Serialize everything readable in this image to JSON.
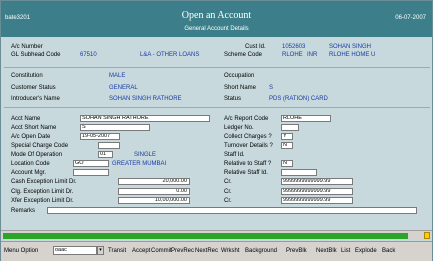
{
  "header": {
    "user": "bate3201",
    "title": "Open an Account",
    "subtitle": "General Account Details",
    "date": "06-07-2007"
  },
  "account": {
    "ac_number_label": "A/c Number",
    "gl_label": "GL Subhead Code",
    "gl_value": "67510",
    "gl_desc": "L&A - OTHER LOANS",
    "cust_id_label": "Cust Id.",
    "cust_id": "1052603",
    "cust_name": "SOHAN SINGH",
    "scheme_label": "Scheme Code",
    "scheme_code": "RLOHE",
    "scheme_ccy": "INR",
    "scheme_desc": "RLOHE HOME U"
  },
  "customer": {
    "constitution_label": "Constitution",
    "constitution": "MALE",
    "occupation_label": "Occupation",
    "occupation": "",
    "status_label": "Customer Status",
    "status": "GENERAL",
    "short_name_label": "Short Name",
    "short_name": "S",
    "introducer_label": "Introducer's Name",
    "introducer": "SOHAN SINGH RATHORE",
    "intro_status_label": "Status",
    "intro_status": "PDS (RATION) CARD"
  },
  "form": {
    "acct_name_label": "Acct Name",
    "acct_name": "SOHAN SINGH RATHORE",
    "acct_short_label": "Acct Short Name",
    "acct_short": "S",
    "open_date_label": "A/c Open Date",
    "open_date": "19-05-2007",
    "special_charge_label": "Special Charge Code",
    "special_charge": "",
    "mode_label": "Mode Of Operation",
    "mode_code": "01",
    "mode_desc": "SINGLE",
    "location_label": "Location Code",
    "location_code": "GO",
    "location_desc": "GREATER MUMBAI",
    "acct_mgr_label": "Account Mgr.",
    "acct_mgr": "",
    "cash_limit_label": "Cash Exception Limit Dr.",
    "cash_limit_dr": "20,000.00",
    "clg_limit_label": "Clg. Exception Limit Dr.",
    "clg_limit_dr": "0.00",
    "xfer_limit_label": "Xfer Exception Limit Dr.",
    "xfer_limit_dr": "10,00,000.00",
    "remarks_label": "Remarks",
    "remarks": "",
    "report_code_label": "A/c Report Code",
    "report_code": "RLOHE",
    "ledger_label": "Ledger No.",
    "ledger": "",
    "collect_label": "Collect Charges ?",
    "collect": "Y",
    "turnover_label": "Turnover Details ?",
    "turnover": "N",
    "staff_label": "Staff Id.",
    "rel_staff_label": "Relative to Staff ?",
    "rel_staff": "N",
    "rel_staff_id_label": "Relative Staff Id.",
    "rel_staff_id": "",
    "cr_label": "Cr.",
    "cash_limit_cr": "9999999999999.99",
    "clg_limit_cr": "9999999999999.99",
    "xfer_limit_cr": "9999999999999.99"
  },
  "progress": {
    "fraction": 0.97
  },
  "bottom": {
    "menu_option_label": "Menu Option",
    "menu_option_value": "oaac",
    "buttons": [
      "Transit",
      "Accept",
      "Commit",
      "PrevRec",
      "NextRec",
      "Wrksht",
      "Background",
      "PrevBlk",
      "NextBlk",
      "List",
      "Explode",
      "Back"
    ]
  }
}
